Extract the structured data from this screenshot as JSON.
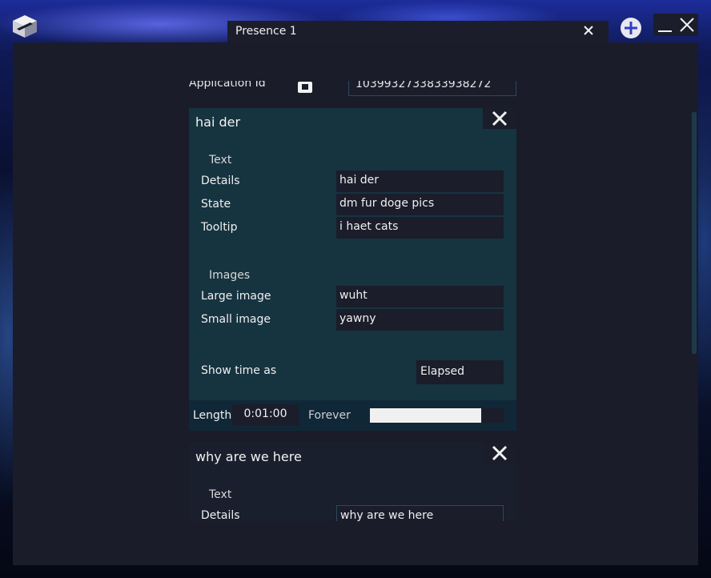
{
  "tab": {
    "title": "Presence 1"
  },
  "header": {
    "app_id_label": "Application Id",
    "app_id_value": "1039932733833938272"
  },
  "cards": [
    {
      "title": "hai der",
      "text_section": "Text",
      "fields": [
        {
          "label": "Details",
          "value": "hai der"
        },
        {
          "label": "State",
          "value": "dm fur doge pics"
        },
        {
          "label": "Tooltip",
          "value": "i haet cats"
        }
      ],
      "images_section": "Images",
      "image_fields": [
        {
          "label": "Large image",
          "value": "wuht"
        },
        {
          "label": "Small image",
          "value": "yawny"
        }
      ],
      "show_time_label": "Show time as",
      "show_time_value": "Elapsed",
      "length_label": "Length",
      "length_value": "0:01:00",
      "forever_label": "Forever",
      "forever_slider_fraction": 0.83
    },
    {
      "title": "why are we here",
      "text_section": "Text",
      "fields": [
        {
          "label": "Details",
          "value": "why are we here"
        }
      ]
    }
  ],
  "colors": {
    "window_bg": "#1a1c2a",
    "card_active_bg": "#163340",
    "card_inactive_bg": "#191f2c",
    "input_bg": "#1b1d2b",
    "accent": "#2a4a5c"
  },
  "icons": {
    "app_logo": "cube-icon",
    "tab_close": "close-icon",
    "add_tab": "plus-circle-icon",
    "minimize": "minimize-icon",
    "window_close": "close-icon",
    "copy": "copy-icon",
    "card_close": "close-icon"
  }
}
